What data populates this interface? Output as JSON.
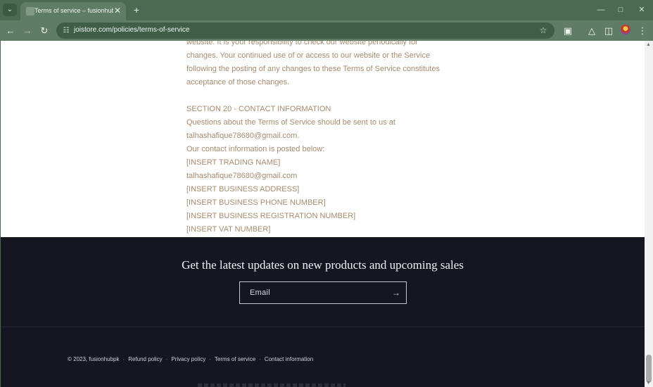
{
  "browser": {
    "tab_title": "Terms of service – fusionhubpk",
    "url": "joistore.com/policies/terms-of-service",
    "icons": {
      "tab_menu": "chevron-down-icon",
      "tab_close": "close-icon",
      "new_tab": "plus-icon",
      "back": "arrow-left-icon",
      "forward": "arrow-right-icon",
      "reload": "reload-icon",
      "site_info": "tune-icon",
      "bookmark": "star-icon",
      "extensions": "puzzle-icon",
      "labs": "flask-icon",
      "side_panel": "side-panel-icon",
      "menu": "kebab-menu-icon"
    }
  },
  "policy": {
    "lines_top": [
      "website. It is your responsibility to check our website periodically for",
      "changes. Your continued use of or access to our website or the Service",
      "following the posting of any changes to these Terms of Service constitutes",
      "acceptance of those changes."
    ],
    "section_heading": "SECTION 20 - CONTACT INFORMATION",
    "lines_contact": [
      "Questions about the Terms of Service should be sent to us at",
      "talhashafique78680@gmail.com.",
      "Our contact information is posted below:",
      "[INSERT TRADING NAME]",
      "talhashafique78680@gmail.com",
      "[INSERT BUSINESS ADDRESS]",
      "[INSERT BUSINESS PHONE NUMBER]",
      "[INSERT BUSINESS REGISTRATION NUMBER]",
      "[INSERT VAT NUMBER]"
    ]
  },
  "footer": {
    "newsletter_heading": "Get the latest updates on new products and upcoming sales",
    "email_placeholder": "Email",
    "submit_icon": "arrow-right-icon",
    "copyright": "© 2023, fusionhubpk",
    "links": [
      "Refund policy",
      "Privacy policy",
      "Terms of service",
      "Contact information"
    ],
    "separator": "·"
  },
  "colors": {
    "chrome_frame": "#4a6b52",
    "toolbar": "#5f7d66",
    "policy_text": "#a68b6e",
    "footer_bg": "#141720",
    "footer_text": "#f0f1f3"
  }
}
